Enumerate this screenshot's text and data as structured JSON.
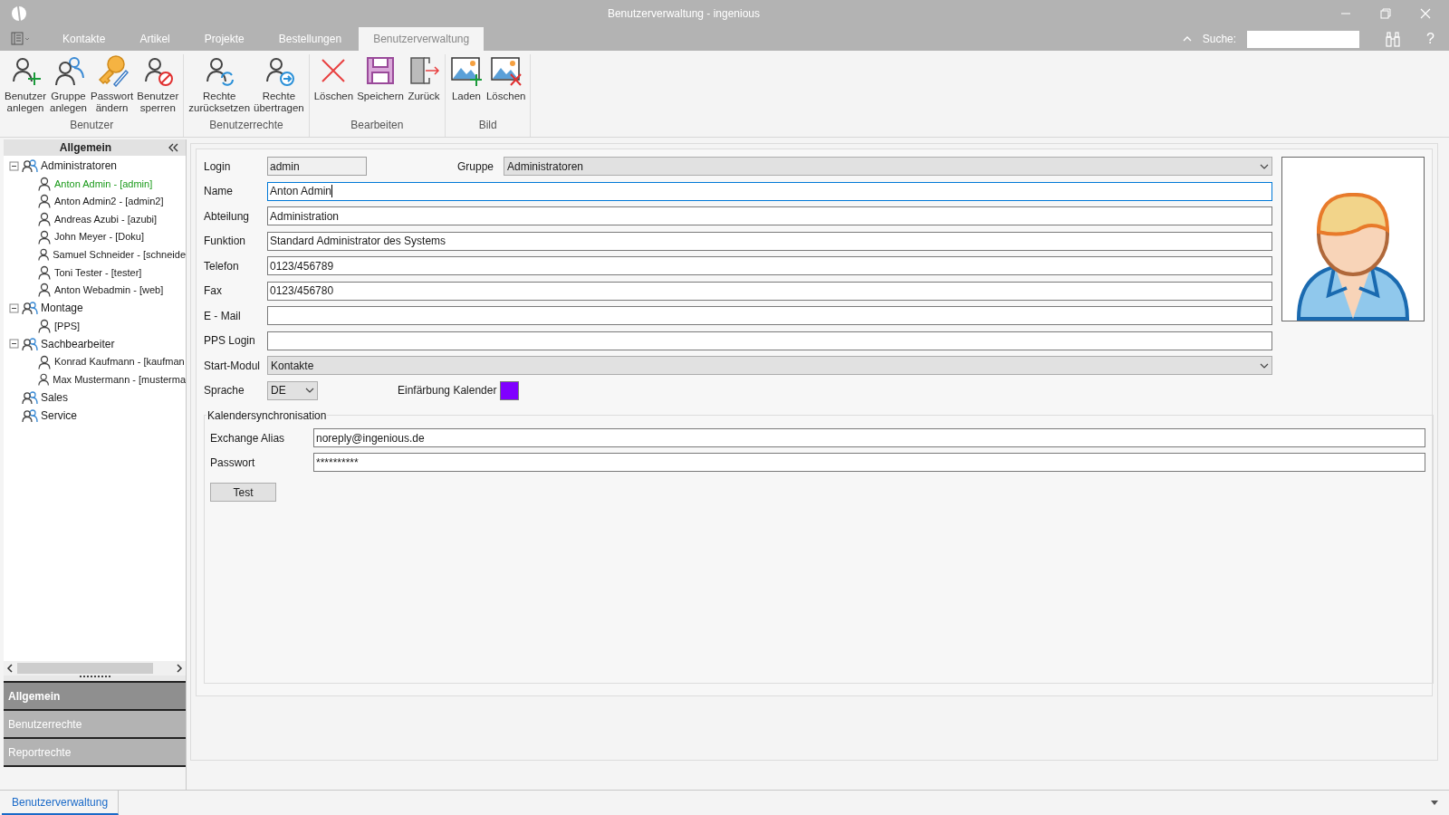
{
  "window": {
    "title": "Benutzerverwaltung - ingenious"
  },
  "menu_tabs": [
    {
      "label": "Kontakte",
      "selected": false
    },
    {
      "label": "Artikel",
      "selected": false
    },
    {
      "label": "Projekte",
      "selected": false
    },
    {
      "label": "Bestellungen",
      "selected": false
    },
    {
      "label": "Benutzerverwaltung",
      "selected": true
    }
  ],
  "search": {
    "label": "Suche:",
    "help": "?"
  },
  "ribbon": [
    {
      "label": "Benutzer",
      "buttons": [
        {
          "label": "Benutzer\nanlegen",
          "kind": "user-add"
        },
        {
          "label": "Gruppe\nanlegen",
          "kind": "group"
        },
        {
          "label": "Passwort\nändern",
          "kind": "key"
        },
        {
          "label": "Benutzer\nsperren",
          "kind": "user-block"
        }
      ]
    },
    {
      "label": "Benutzerrechte",
      "buttons": [
        {
          "label": "Rechte\nzurücksetzen",
          "kind": "user-refresh"
        },
        {
          "label": "Rechte\nübertragen",
          "kind": "user-forward"
        }
      ]
    },
    {
      "label": "Bearbeiten",
      "buttons": [
        {
          "label": "Löschen",
          "kind": "delete"
        },
        {
          "label": "Speichern",
          "kind": "save"
        },
        {
          "label": "Zurück",
          "kind": "exit"
        }
      ]
    },
    {
      "label": "Bild",
      "buttons": [
        {
          "label": "Laden",
          "kind": "image-add"
        },
        {
          "label": "Löschen",
          "kind": "image-delete"
        }
      ]
    }
  ],
  "sidebar": {
    "title": "Allgemein",
    "tree": [
      {
        "label": "Administratoren",
        "expanded": true,
        "selected": false,
        "children": [
          {
            "label": "Anton Admin - [admin]",
            "selected": true
          },
          {
            "label": "Anton Admin2 - [admin2]",
            "selected": false
          },
          {
            "label": "Andreas Azubi - [azubi]",
            "selected": false
          },
          {
            "label": "John Meyer - [Doku]",
            "selected": false
          },
          {
            "label": "Samuel Schneider - [schneide",
            "selected": false
          },
          {
            "label": "Toni Tester - [tester]",
            "selected": false
          },
          {
            "label": "Anton Webadmin - [web]",
            "selected": false
          }
        ]
      },
      {
        "label": "Montage",
        "expanded": true,
        "selected": false,
        "children": [
          {
            "label": "[PPS]",
            "selected": false
          }
        ]
      },
      {
        "label": "Sachbearbeiter",
        "expanded": true,
        "selected": false,
        "children": [
          {
            "label": "Konrad Kaufmann - [kaufman",
            "selected": false
          },
          {
            "label": "Max Mustermann - [musterma",
            "selected": false
          }
        ]
      },
      {
        "label": "Sales",
        "selected": false
      },
      {
        "label": "Service",
        "selected": false
      }
    ],
    "sections": [
      {
        "label": "Allgemein",
        "selected": true
      },
      {
        "label": "Benutzerrechte",
        "selected": false
      },
      {
        "label": "Reportrechte",
        "selected": false
      }
    ]
  },
  "form": {
    "login": {
      "label": "Login",
      "value": "admin"
    },
    "group": {
      "label": "Gruppe",
      "value": "Administratoren"
    },
    "fields": [
      {
        "label": "Name",
        "value": "Anton Admin",
        "focused": true
      },
      {
        "label": "Abteilung",
        "value": "Administration",
        "focused": false
      },
      {
        "label": "Funktion",
        "value": "Standard Administrator des Systems",
        "focused": false
      },
      {
        "label": "Telefon",
        "value": "0123/456789",
        "focused": false
      },
      {
        "label": "Fax",
        "value": "0123/456780",
        "focused": false
      },
      {
        "label": "E - Mail",
        "focused": false
      },
      {
        "label": "PPS Login",
        "focused": false
      }
    ],
    "start_module": {
      "label": "Start-Modul",
      "value": "Kontakte"
    },
    "language": {
      "label": "Sprache",
      "value": "DE"
    },
    "calendar_color": {
      "label": "Einfärbung Kalender",
      "color": "#8000ff"
    },
    "sync": {
      "title": "Kalendersynchronisation",
      "fields": [
        {
          "label": "Exchange Alias",
          "value": "noreply@ingenious.de"
        },
        {
          "label": "Passwort",
          "value": "**********"
        }
      ],
      "button": "Test"
    }
  },
  "bottom_tabs": [
    {
      "label": "Benutzerverwaltung",
      "selected": true
    }
  ]
}
